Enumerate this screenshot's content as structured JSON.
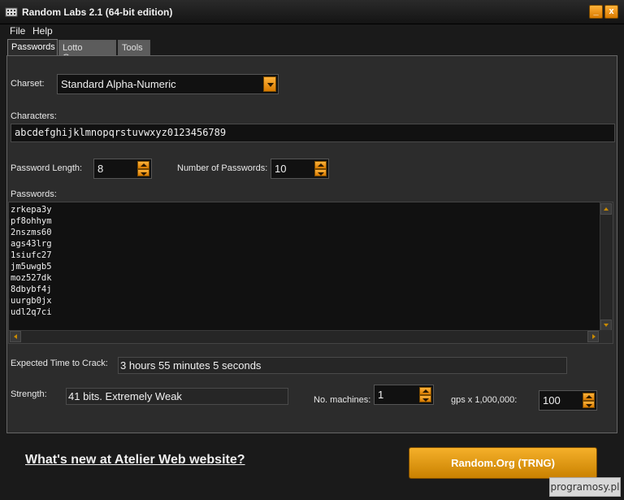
{
  "window": {
    "title": "Random Labs 2.1 (64-bit edition)",
    "minimize_label": "_",
    "close_label": "x"
  },
  "menu": {
    "items": [
      "File",
      "Help"
    ]
  },
  "tabs": [
    {
      "label": "Passwords",
      "active": true
    },
    {
      "label": "Lotto Games",
      "active": false
    },
    {
      "label": "Tools",
      "active": false
    }
  ],
  "passwords_tab": {
    "charset_label": "Charset:",
    "charset_value": "Standard Alpha-Numeric",
    "characters_label": "Characters:",
    "characters_value": "abcdefghijklmnopqrstuvwxyz0123456789",
    "length_label": "Password Length:",
    "length_value": "8",
    "count_label": "Number of Passwords:",
    "count_value": "10",
    "passwords_label": "Passwords:",
    "passwords": [
      "zrkepa3y",
      "pf8ohhym",
      "2nszms60",
      "ags43lrg",
      "1siufc27",
      "jm5uwgb5",
      "moz527dk",
      "8dbybf4j",
      "uurgb0jx",
      "udl2q7ci"
    ],
    "crack_label": "Expected Time to Crack:",
    "crack_value": "3 hours 55 minutes 5 seconds",
    "strength_label": "Strength:",
    "strength_value": "41 bits. Extremely Weak",
    "machines_label": "No. machines:",
    "machines_value": "1",
    "gps_label": "gps x 1,000,000:",
    "gps_value": "100"
  },
  "footer": {
    "link_text": "What's new at Atelier Web website?",
    "trng_button": "Random.Org (TRNG)"
  },
  "watermark": "programosy.pl",
  "colors": {
    "accent": "#f0a020",
    "background": "#2c2c2c",
    "field": "#111111"
  }
}
